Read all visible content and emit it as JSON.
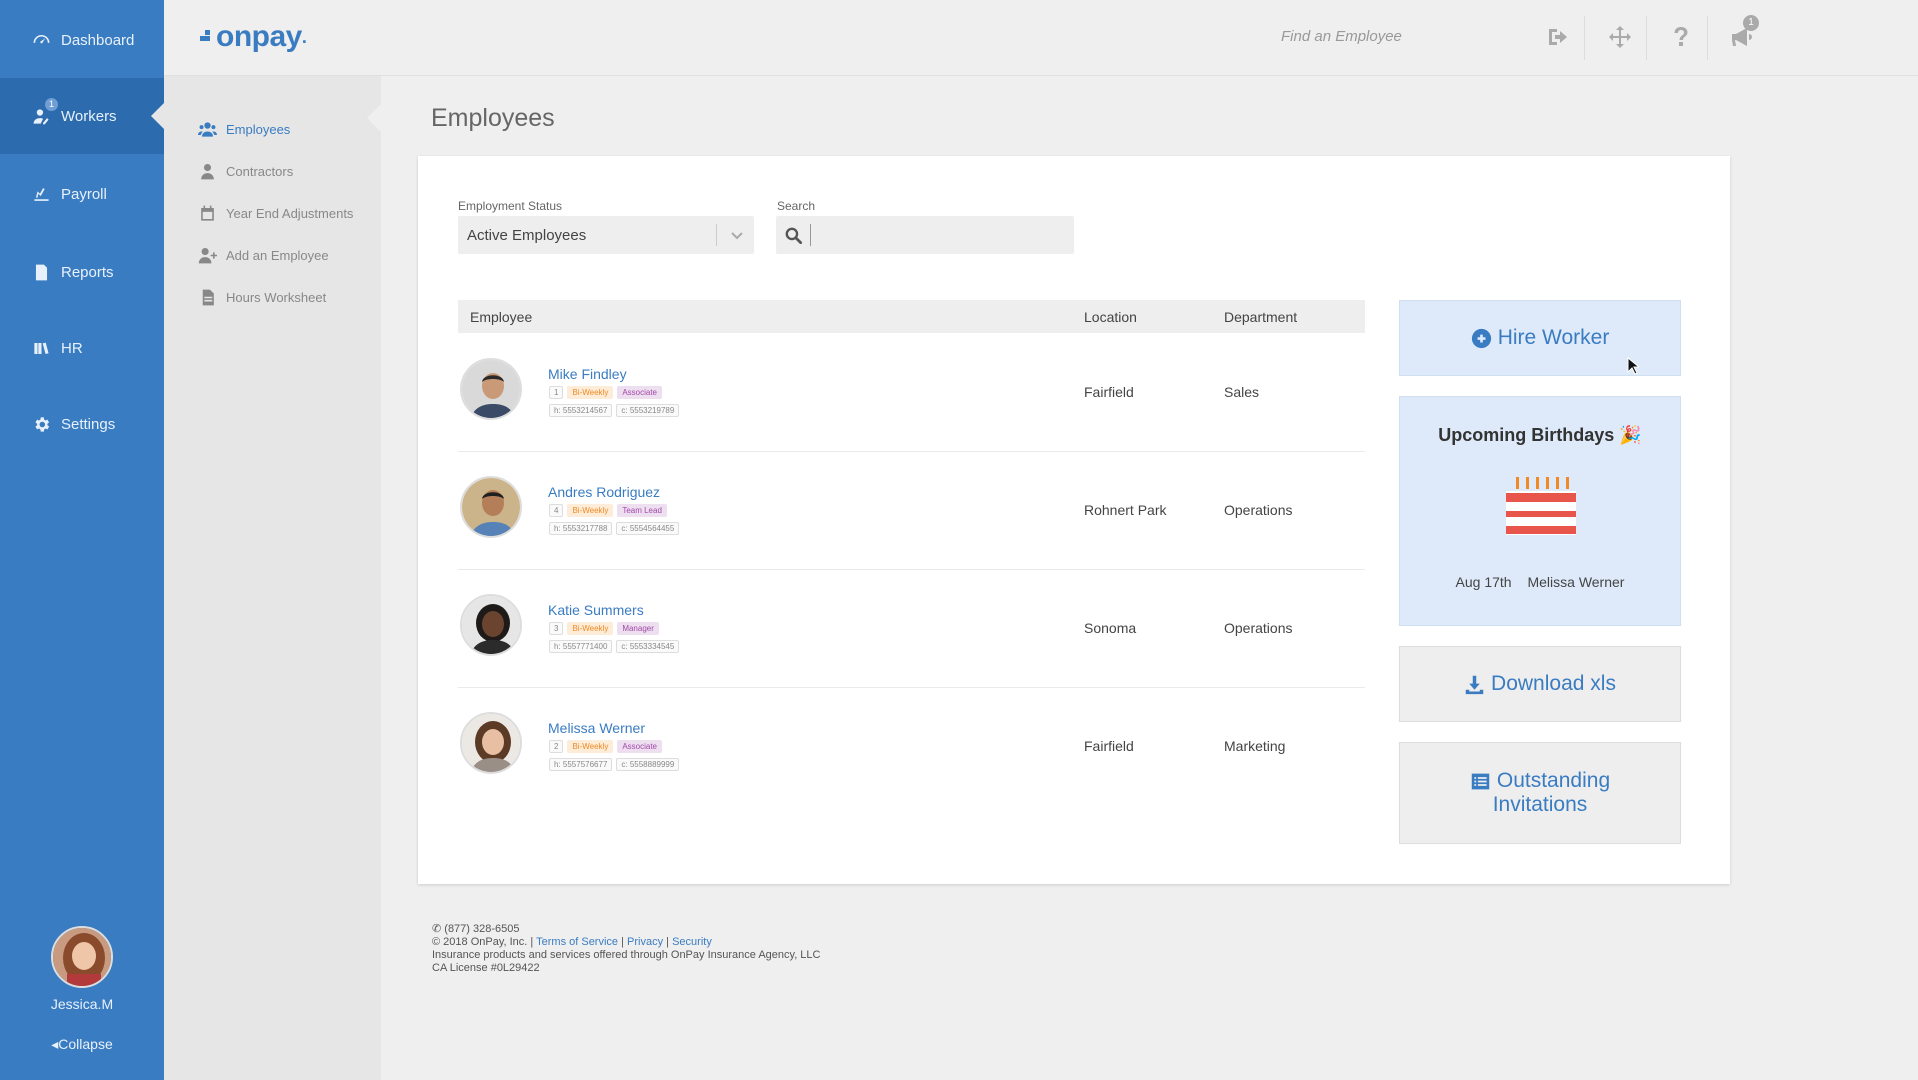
{
  "nav": {
    "items": [
      {
        "label": "Dashboard",
        "icon": "gauge-icon"
      },
      {
        "label": "Workers",
        "icon": "worker-icon",
        "badge": "1"
      },
      {
        "label": "Payroll",
        "icon": "payroll-icon"
      },
      {
        "label": "Reports",
        "icon": "reports-icon"
      },
      {
        "label": "HR",
        "icon": "books-icon"
      },
      {
        "label": "Settings",
        "icon": "gear-icon"
      }
    ],
    "user_name": "Jessica.M",
    "collapse_label": "Collapse"
  },
  "subnav": {
    "items": [
      {
        "label": "Employees",
        "icon": "users-icon"
      },
      {
        "label": "Contractors",
        "icon": "user-icon"
      },
      {
        "label": "Year End Adjustments",
        "icon": "calendar-icon"
      },
      {
        "label": "Add an Employee",
        "icon": "user-plus-icon"
      },
      {
        "label": "Hours Worksheet",
        "icon": "file-icon"
      }
    ]
  },
  "topbar": {
    "logo": "onpay",
    "find_placeholder": "Find an Employee",
    "notifications_badge": "1"
  },
  "page": {
    "title": "Employees",
    "employment_status_label": "Employment Status",
    "employment_status_value": "Active Employees",
    "search_label": "Search",
    "search_value": ""
  },
  "table": {
    "headers": {
      "employee": "Employee",
      "location": "Location",
      "department": "Department"
    },
    "rows": [
      {
        "name": "Mike Findley",
        "num": "1",
        "freq": "Bi-Weekly",
        "role": "Associate",
        "home": "h: 5553214567",
        "cell": "c: 5553219789",
        "location": "Fairfield",
        "department": "Sales"
      },
      {
        "name": "Andres Rodriguez",
        "num": "4",
        "freq": "Bi-Weekly",
        "role": "Team Lead",
        "home": "h: 5553217788",
        "cell": "c: 5554564455",
        "location": "Rohnert Park",
        "department": "Operations"
      },
      {
        "name": "Katie Summers",
        "num": "3",
        "freq": "Bi-Weekly",
        "role": "Manager",
        "home": "h: 5557771400",
        "cell": "c: 5553334545",
        "location": "Sonoma",
        "department": "Operations"
      },
      {
        "name": "Melissa Werner",
        "num": "2",
        "freq": "Bi-Weekly",
        "role": "Associate",
        "home": "h: 5557576677",
        "cell": "c: 5558889999",
        "location": "Fairfield",
        "department": "Marketing"
      }
    ]
  },
  "side": {
    "hire_label": "Hire Worker",
    "birthdays_title": "Upcoming Birthdays",
    "birthday_date": "Aug 17th",
    "birthday_name": "Melissa Werner",
    "download_label": "Download xls",
    "invitations_label_1": "Outstanding",
    "invitations_label_2": "Invitations"
  },
  "footer": {
    "phone": "(877) 328-6505",
    "copyright": "© 2018 OnPay, Inc. |",
    "terms": "Terms of Service",
    "privacy": "Privacy",
    "security": "Security",
    "insurance": "Insurance products and services offered through OnPay Insurance Agency, LLC",
    "license": "CA License #0L29422"
  },
  "colors": {
    "brand": "#3a7cc2",
    "nav_active": "#2c6bae",
    "freq_tag": "#f08a24",
    "role_tag": "#a14aa8"
  }
}
